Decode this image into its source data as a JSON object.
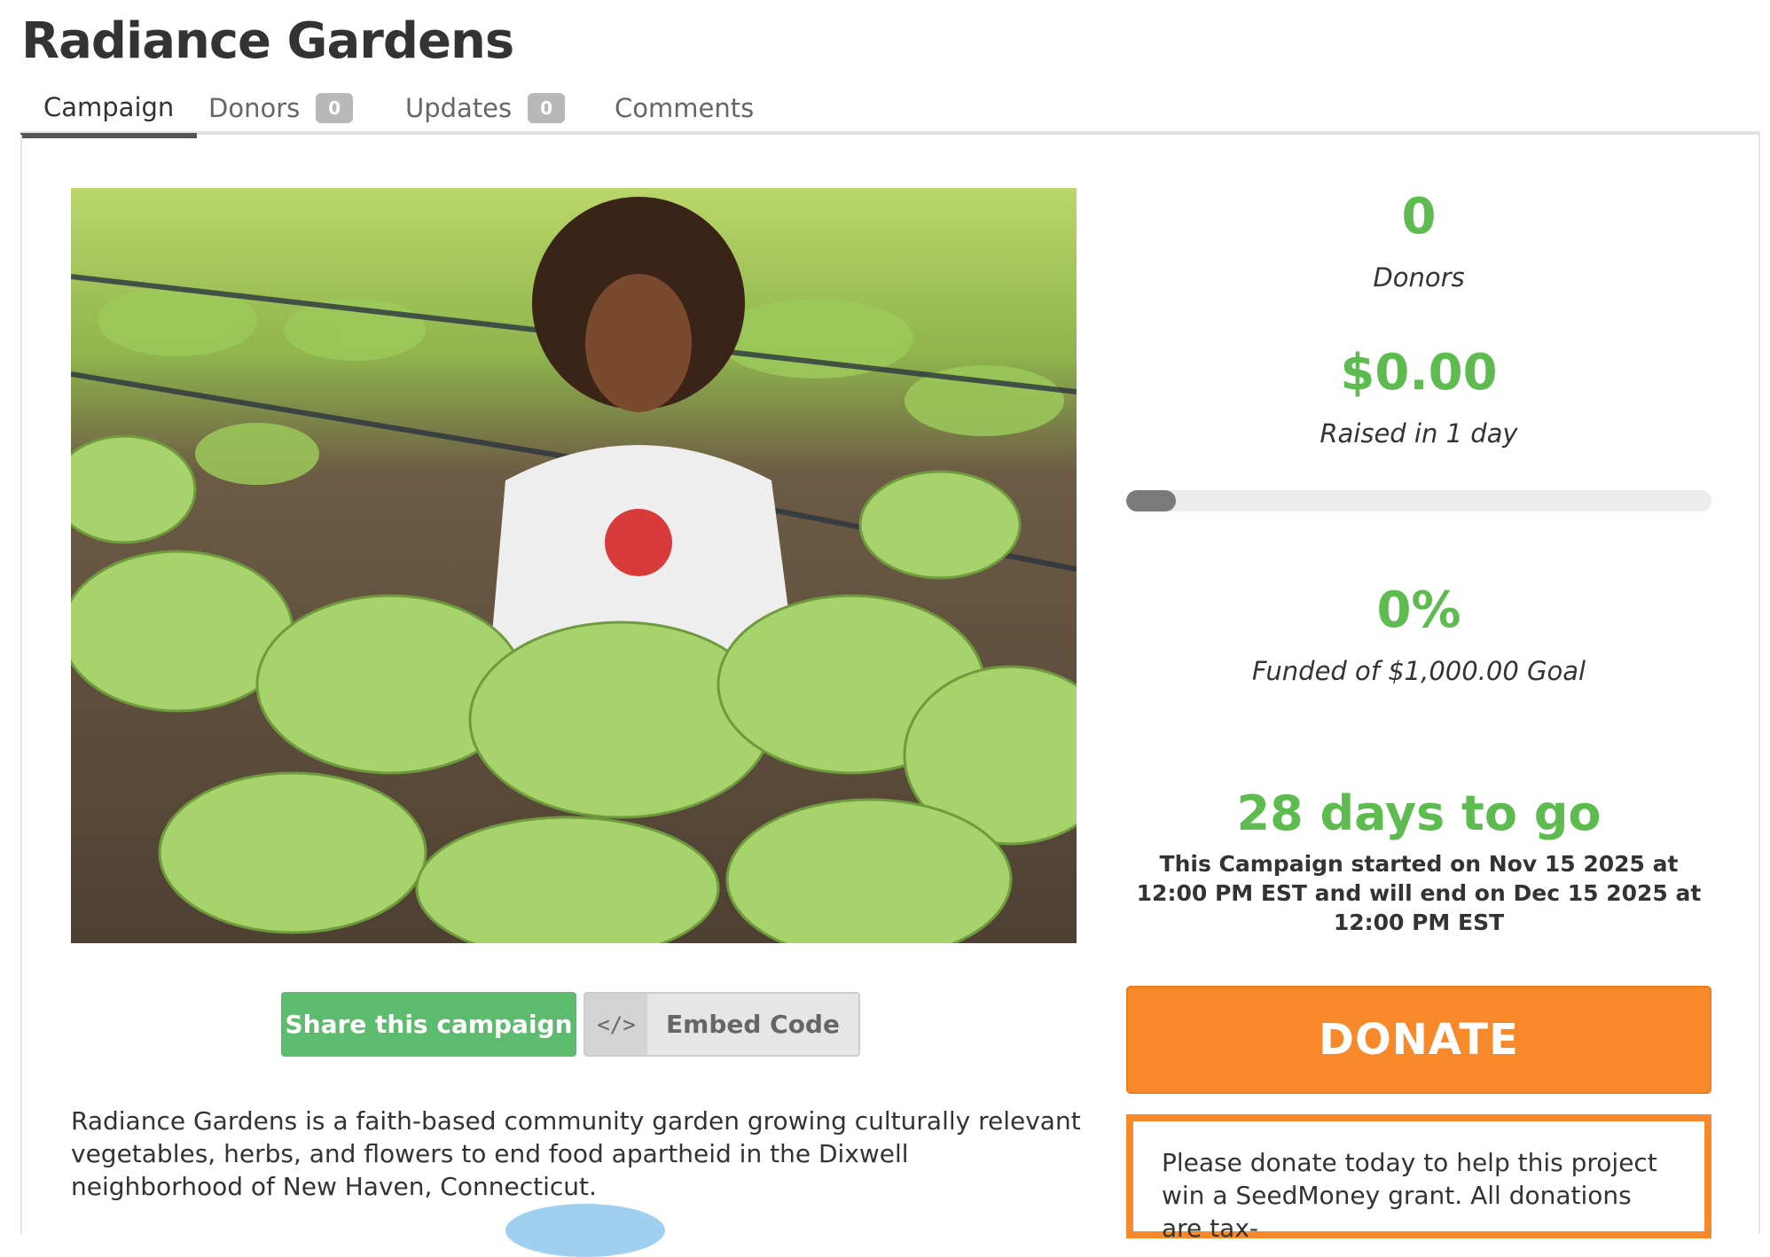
{
  "page": {
    "title": "Radiance Gardens"
  },
  "tabs": [
    {
      "label": "Campaign",
      "count": null
    },
    {
      "label": "Donors",
      "count": "0"
    },
    {
      "label": "Updates",
      "count": "0"
    },
    {
      "label": "Comments",
      "count": null
    }
  ],
  "stats": {
    "donors_value": "0",
    "donors_label": "Donors",
    "raised_value": "$0.00",
    "raised_label": "Raised in 1 day",
    "progress_fraction": 0,
    "funded_value": "0%",
    "funded_label": "Funded of $1,000.00 Goal",
    "days_value": "28 days to go",
    "dates_text": "This Campaign started on Nov 15 2025 at 12:00 PM EST and will end on Dec 15 2025 at 12:00 PM EST"
  },
  "actions": {
    "share_label": "Share this campaign",
    "embed_label": "Embed Code",
    "embed_icon": "</>",
    "donate_label": "DONATE"
  },
  "description": "Radiance Gardens is a faith-based community garden growing culturally relevant vegetables, herbs, and flowers to end food apartheid in the Dixwell neighborhood of New Haven, Connecticut.",
  "promo": "Please donate today to help this project win a SeedMoney grant. All donations are tax-",
  "colors": {
    "accent_green": "#5dbb4f",
    "share_green": "#5dbb6d",
    "donate_orange": "#f7892a"
  }
}
